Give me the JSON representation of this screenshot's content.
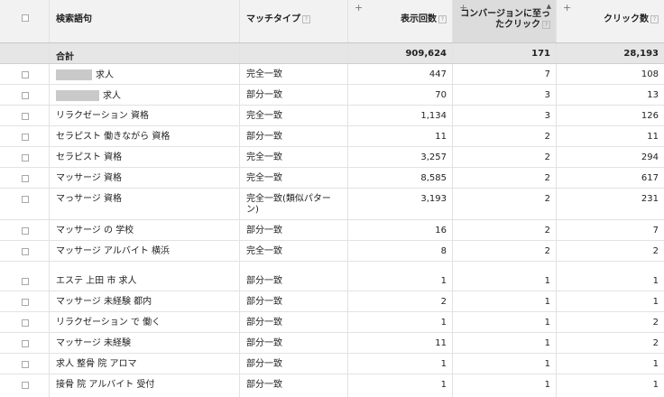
{
  "header": {
    "keyword": "検索語句",
    "match_type": "マッチタイプ",
    "impressions": "表示回数",
    "conversions_line1": "コンバージョンに至っ",
    "conversions_line2": "たクリック",
    "clicks": "クリック数",
    "plus": "+",
    "help": "?",
    "sort": "▲"
  },
  "total": {
    "label": "合計",
    "impressions": "909,624",
    "conversions": "171",
    "clicks": "28,193"
  },
  "rows": [
    {
      "keyword": "求人",
      "redacted": true,
      "match": "完全一致",
      "impressions": "447",
      "conversions": "7",
      "clicks": "108"
    },
    {
      "keyword": "求人",
      "redacted": true,
      "match": "部分一致",
      "impressions": "70",
      "conversions": "3",
      "clicks": "13"
    },
    {
      "keyword": "リラクゼーション 資格",
      "match": "完全一致",
      "impressions": "1,134",
      "conversions": "3",
      "clicks": "126"
    },
    {
      "keyword": "セラピスト 働きながら 資格",
      "match": "部分一致",
      "impressions": "11",
      "conversions": "2",
      "clicks": "11"
    },
    {
      "keyword": "セラピスト 資格",
      "match": "完全一致",
      "impressions": "3,257",
      "conversions": "2",
      "clicks": "294"
    },
    {
      "keyword": "マッサージ 資格",
      "match": "完全一致",
      "impressions": "8,585",
      "conversions": "2",
      "clicks": "617"
    },
    {
      "keyword": "マっサージ 資格",
      "match": "完全一致(類似パターン)",
      "match_line1": "完全一致(類似パター",
      "match_line2": "ン)",
      "impressions": "3,193",
      "conversions": "2",
      "clicks": "231"
    },
    {
      "keyword": "マッサージ の 学校",
      "match": "部分一致",
      "impressions": "16",
      "conversions": "2",
      "clicks": "7"
    },
    {
      "keyword": "マッサージ アルバイト 横浜",
      "match": "完全一致",
      "impressions": "8",
      "conversions": "2",
      "clicks": "2"
    },
    {
      "keyword": "エステ 上田 市 求人",
      "match": "部分一致",
      "impressions": "1",
      "conversions": "1",
      "clicks": "1"
    },
    {
      "keyword": "マッサージ 未経験 都内",
      "match": "部分一致",
      "impressions": "2",
      "conversions": "1",
      "clicks": "1"
    },
    {
      "keyword": "リラクゼーション で 働く",
      "match": "部分一致",
      "impressions": "1",
      "conversions": "1",
      "clicks": "2"
    },
    {
      "keyword": "マッサージ 未経験",
      "match": "部分一致",
      "impressions": "11",
      "conversions": "1",
      "clicks": "2"
    },
    {
      "keyword": "求人 整骨 院 アロマ",
      "match": "部分一致",
      "impressions": "1",
      "conversions": "1",
      "clicks": "1"
    },
    {
      "keyword": "接骨 院 アルバイト 受付",
      "match": "部分一致",
      "impressions": "1",
      "conversions": "1",
      "clicks": "1"
    }
  ]
}
